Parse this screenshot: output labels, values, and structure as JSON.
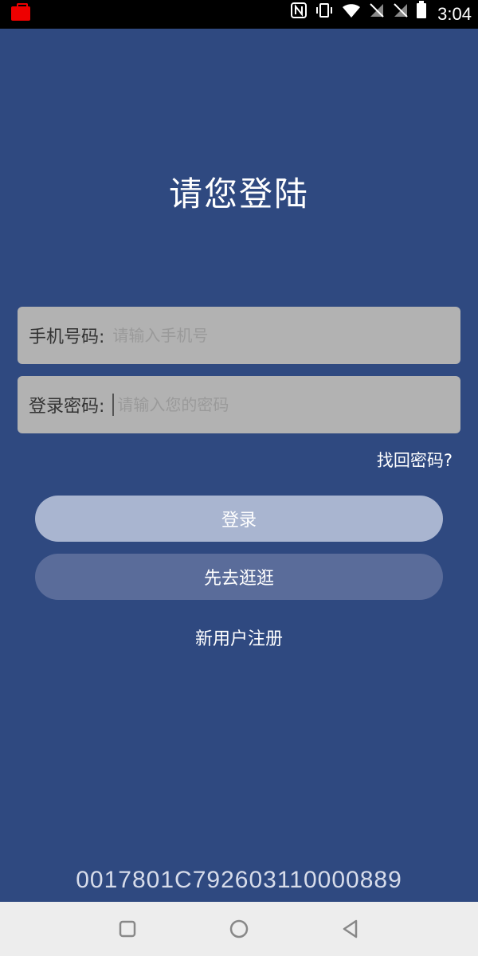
{
  "status_bar": {
    "time": "3:04",
    "icons": [
      "nfc-icon",
      "vibrate-icon",
      "wifi-icon",
      "no-sim-icon",
      "no-sim-icon",
      "battery-icon"
    ]
  },
  "page": {
    "title": "请您登陆"
  },
  "form": {
    "phone_label": "手机号码:",
    "phone_placeholder": "请输入手机号",
    "phone_value": "",
    "password_label": "登录密码:",
    "password_placeholder": "请输入您的密码",
    "password_value": "",
    "forgot_password": "找回密码?"
  },
  "actions": {
    "login_label": "登录",
    "browse_label": "先去逛逛",
    "register_label": "新用户注册"
  },
  "footer": {
    "device_id": "0017801C792603110000889"
  },
  "colors": {
    "background": "#2f4980",
    "field": "#b2b2b2",
    "login_button": "#a9b5d0",
    "browse_button": "#5a6c9a"
  }
}
